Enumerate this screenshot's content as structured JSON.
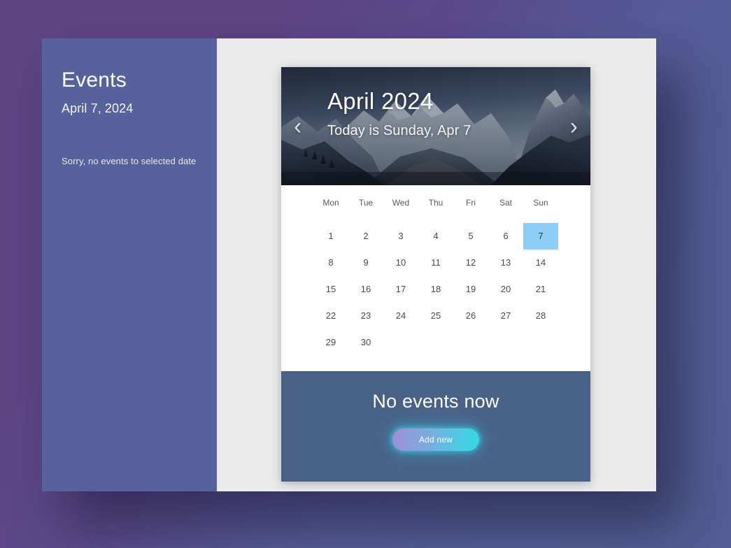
{
  "background": {
    "gradient_start": "#5d4584",
    "gradient_end": "#515e94"
  },
  "sidebar": {
    "title": "Events",
    "date": "April 7, 2024",
    "empty_message": "Sorry, no events to selected date",
    "background_color": "#56629b"
  },
  "calendar": {
    "header": {
      "month_title": "April 2024",
      "today_label": "Today is Sunday, Apr 7",
      "prev_arrow": "chevron-left-icon",
      "next_arrow": "chevron-right-icon",
      "prev_glyph": "‹",
      "next_glyph": "›",
      "image": "mountain-landscape-photo"
    },
    "weekdays": [
      "Mon",
      "Tue",
      "Wed",
      "Thu",
      "Fri",
      "Sat",
      "Sun"
    ],
    "weeks": [
      [
        "1",
        "2",
        "3",
        "4",
        "5",
        "6",
        "7"
      ],
      [
        "8",
        "9",
        "10",
        "11",
        "12",
        "13",
        "14"
      ],
      [
        "15",
        "16",
        "17",
        "18",
        "19",
        "20",
        "21"
      ],
      [
        "22",
        "23",
        "24",
        "25",
        "26",
        "27",
        "28"
      ],
      [
        "29",
        "30",
        "",
        "",
        "",
        "",
        ""
      ]
    ],
    "selected_day": "7",
    "selected_color": "#8ecdf7",
    "footer": {
      "message": "No events now",
      "button_label": "Add new",
      "background_color": "#4a6186",
      "button_gradient_start": "#9d8fd6",
      "button_gradient_end": "#35d8e4"
    }
  }
}
